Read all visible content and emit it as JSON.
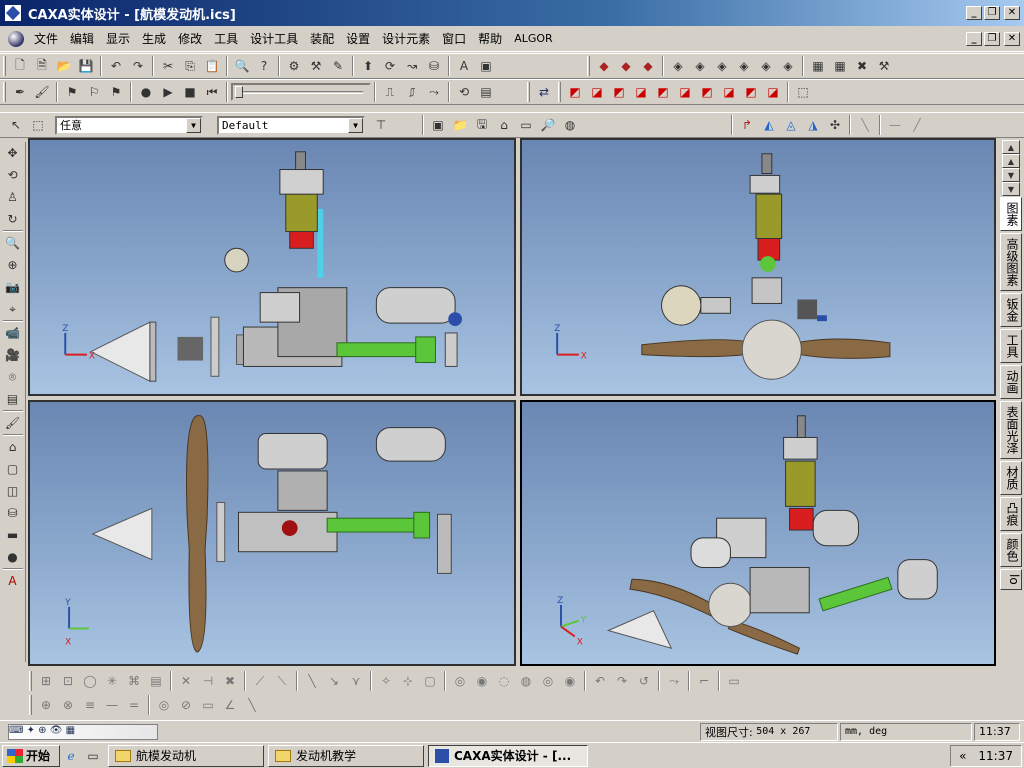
{
  "window": {
    "title": "CAXA实体设计 - [航模发动机.ics]",
    "min_label": "_",
    "max_label": "❐",
    "close_label": "✕"
  },
  "menu": {
    "items": [
      "文件",
      "编辑",
      "显示",
      "生成",
      "修改",
      "工具",
      "设计工具",
      "装配",
      "设置",
      "设计元素",
      "窗口",
      "帮助",
      "ALGOR"
    ]
  },
  "toolbar3": {
    "filter_value": "任意",
    "style_value": "Default"
  },
  "right_tabs": [
    "图素",
    "高级图素",
    "钣金",
    "工具",
    "动画",
    "表面光泽",
    "材质",
    "凸痕",
    "颜色",
    "lo"
  ],
  "viewports": {
    "top_left": {
      "axes": [
        "Z",
        "X"
      ]
    },
    "top_right": {
      "axes": [
        "Z",
        "X"
      ]
    },
    "bottom_left": {
      "axes": [
        "Y",
        "X"
      ]
    },
    "bottom_right": {
      "axes": [
        "Z",
        "Y",
        "X"
      ]
    }
  },
  "status": {
    "view_size_label": "视图尺寸:",
    "view_size_value": "504 x 267",
    "units": "mm, deg",
    "clock": "11:37"
  },
  "taskbar": {
    "start_label": "开始",
    "tasks": [
      "航模发动机",
      "发动机教学",
      "CAXA实体设计 - [..."
    ],
    "tray_arrow": "«",
    "clock": "11:37"
  },
  "colors": {
    "titlebar": "#0a246a",
    "viewport_bg": "#8aa7cc",
    "model_green": "#5cc63a",
    "model_red": "#d81e1e",
    "model_olive": "#9a9a2a",
    "prop_brown": "#8a6a45"
  }
}
